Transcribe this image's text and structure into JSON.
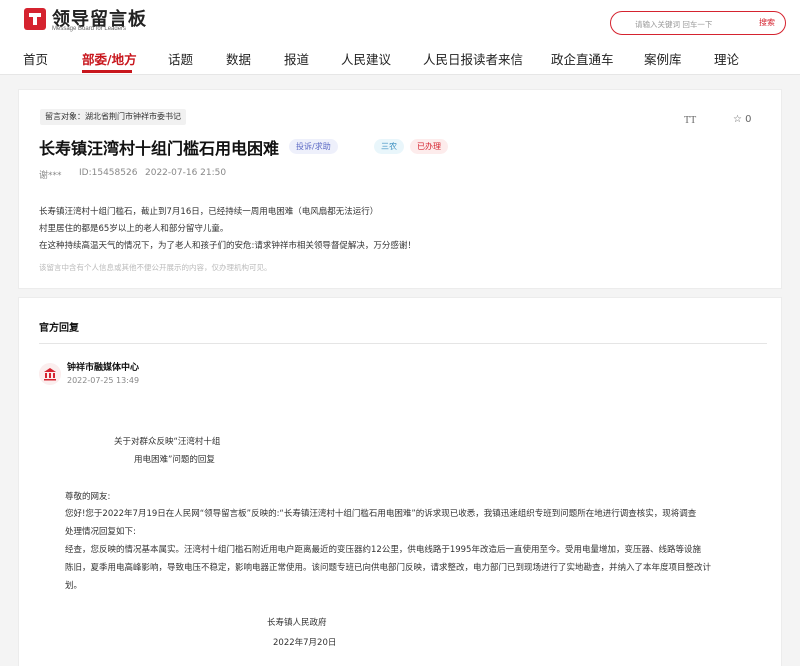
{
  "header": {
    "logo_text": "领导留言板",
    "logo_sub": "Message Board for Leaders",
    "search_placeholder": "请输入关键词 回车一下",
    "search_button": "搜索",
    "nav": [
      "首页",
      "部委/地方",
      "话题",
      "数据",
      "报道",
      "人民建议",
      "人民日报读者来信",
      "政企直通车",
      "案例库",
      "理论"
    ],
    "active_nav_index": 1
  },
  "message": {
    "target": "留言对象：湖北省荆门市钟祥市委书记",
    "title": "长寿镇汪湾村十组门槛石用电困难",
    "tags": [
      "投诉/求助",
      "三农",
      "已办理"
    ],
    "author": "谢***",
    "id": "ID:15458526",
    "datetime": "2022-07-16 21:50",
    "font_icon": "TT",
    "star_count": "0",
    "body": [
      "长寿镇汪湾村十组门槛石，截止到7月16日，已经持续一周用电困难（电风扇都无法运行）",
      "村里居住的都是65岁以上的老人和部分留守儿童。",
      "在这种持续高温天气的情况下，为了老人和孩子们的安危:请求钟祥市相关领导督促解决，万分感谢！"
    ],
    "disclaimer": "该留言中含有个人信息或其他不便公开展示的内容，仅办理机构可见。"
  },
  "reply": {
    "heading": "官方回复",
    "org": "钟祥市融媒体中心",
    "date": "2022-07-25 13:49",
    "doc_title_1": "关于对群众反映“汪湾村十组",
    "doc_title_2": "用电困难”问题的回复",
    "salutation": "尊敬的网友:",
    "para1_l1": "您好!您于2022年7月19日在人民网“领导留言板”反映的:“长寿镇汪湾村十组门槛石用电困难”的诉求现已收悉，我镇迅速组织专班到问题所在地进行调查核实，现将调查",
    "para1_l2": "处理情况回复如下:",
    "para2_l1": "经查，您反映的情况基本属实。汪湾村十组门槛石附近用电户距离最近的变压器约12公里，供电线路于1995年改造后一直使用至今。受用电量增加，变压器、线路等设施",
    "para2_l2": "陈旧，夏季用电高峰影响，导致电压不稳定，影响电器正常使用。该问题专班已向供电部门反映，请求整改，电力部门已到现场进行了实地勘查，并纳入了本年度项目整改计",
    "para2_l3": "划。",
    "sign_org": "长寿镇人民政府",
    "sign_date": "2022年7月20日"
  },
  "colors": {
    "brand_red": "#c8161d"
  }
}
